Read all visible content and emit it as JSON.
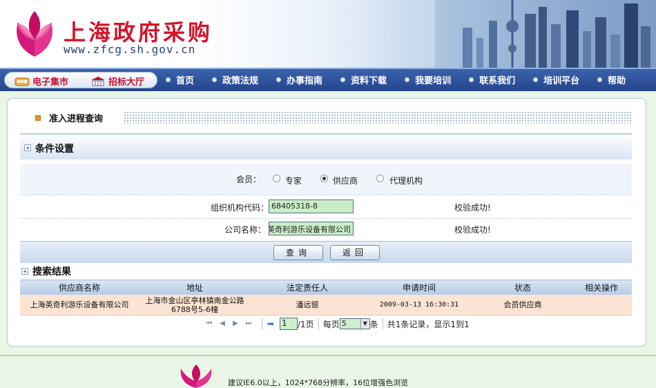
{
  "header": {
    "title": "上海政府采购",
    "url": "www.zfcg.sh.gov.cn"
  },
  "nav": {
    "pill_items": [
      {
        "label": "电子集市",
        "icon": "market-icon"
      },
      {
        "label": "招标大厅",
        "icon": "bidding-hall-icon"
      }
    ],
    "links": [
      "首页",
      "政策法规",
      "办事指南",
      "资料下载",
      "我要培训",
      "联系我们",
      "培训平台",
      "帮助"
    ]
  },
  "page": {
    "title": "准入进程查询"
  },
  "conditions": {
    "section_title": "条件设置",
    "member_label": "会员：",
    "member_options": [
      {
        "label": "专家",
        "selected": false
      },
      {
        "label": "供应商",
        "selected": true
      },
      {
        "label": "代理机构",
        "selected": false
      }
    ],
    "org_code_label": "组织机构代码：",
    "org_code_value": "68405318-8",
    "org_code_status": "校验成功!",
    "company_label": "公司名称：",
    "company_value": "英奇利游乐设备有限公司",
    "company_status": "校验成功!",
    "query_button": "查询",
    "back_button": "返回"
  },
  "results": {
    "section_title": "搜索结果",
    "columns": [
      "供应商名称",
      "地址",
      "法定责任人",
      "申请时间",
      "状态",
      "相关操作"
    ],
    "rows": [
      {
        "supplier": "上海英奇利游乐设备有限公司",
        "address": "上海市金山区亭林镇南金公路6788号5-6幢",
        "legal_person": "潘远银",
        "apply_time": "2009-03-13 16:30:31",
        "status": "会员供应商",
        "actions": ""
      }
    ]
  },
  "pager": {
    "current_page": "1",
    "total_pages_label": "/1页",
    "per_page_label": "每页",
    "per_page_value": "5",
    "per_page_unit": "条",
    "summary": "共1条记录，显示1到1"
  },
  "footer": {
    "note": "建议IE6.0以上，1024*768分辨率，16位增强色浏览"
  },
  "colors": {
    "brand_red": "#d3142a",
    "nav_blue": "#2b4d95",
    "field_green": "#c9eec6",
    "row_highlight": "#fbe4d3"
  }
}
